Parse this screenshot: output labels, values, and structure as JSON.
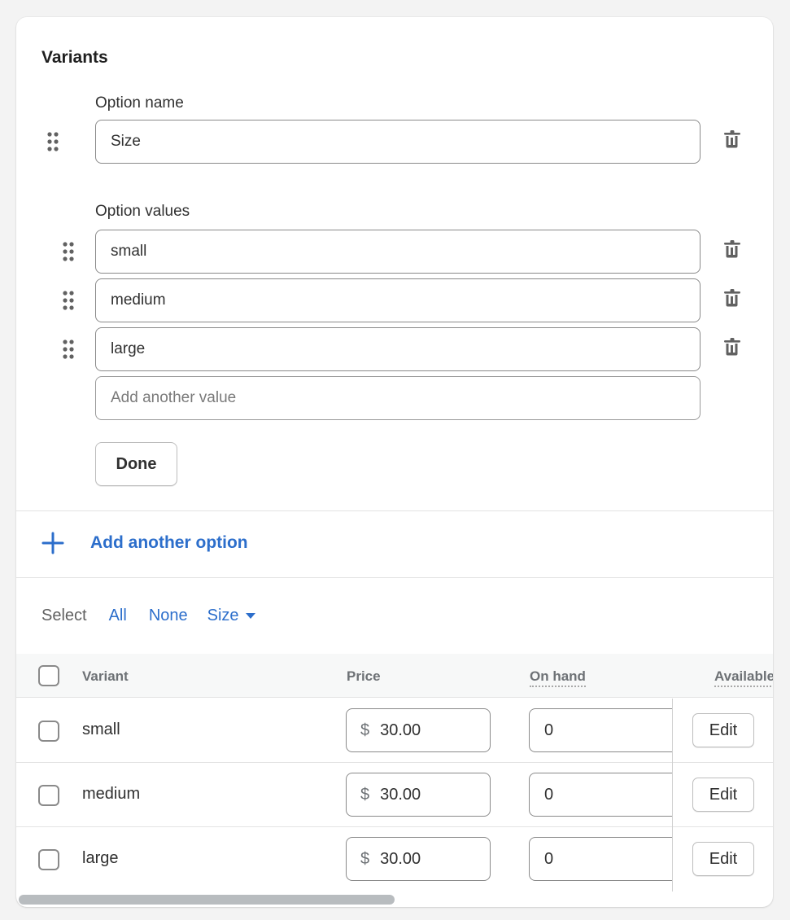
{
  "section": {
    "title": "Variants"
  },
  "option": {
    "name_label": "Option name",
    "name_value": "Size",
    "values_label": "Option values",
    "values": [
      "small",
      "medium",
      "large"
    ],
    "new_value_placeholder": "Add another value",
    "done_label": "Done"
  },
  "add_option": {
    "label": "Add another option"
  },
  "select_bar": {
    "label": "Select",
    "all": "All",
    "none": "None",
    "size": "Size"
  },
  "table": {
    "headers": {
      "variant": "Variant",
      "price": "Price",
      "on_hand": "On hand",
      "available": "Available"
    },
    "rows": [
      {
        "variant": "small",
        "currency": "$",
        "price": "30.00",
        "on_hand": "0",
        "action": "Edit"
      },
      {
        "variant": "medium",
        "currency": "$",
        "price": "30.00",
        "on_hand": "0",
        "action": "Edit"
      },
      {
        "variant": "large",
        "currency": "$",
        "price": "30.00",
        "on_hand": "0",
        "action": "Edit"
      }
    ]
  },
  "colors": {
    "accent": "#2c6ecb",
    "text": "#303030",
    "muted": "#6d7175"
  }
}
